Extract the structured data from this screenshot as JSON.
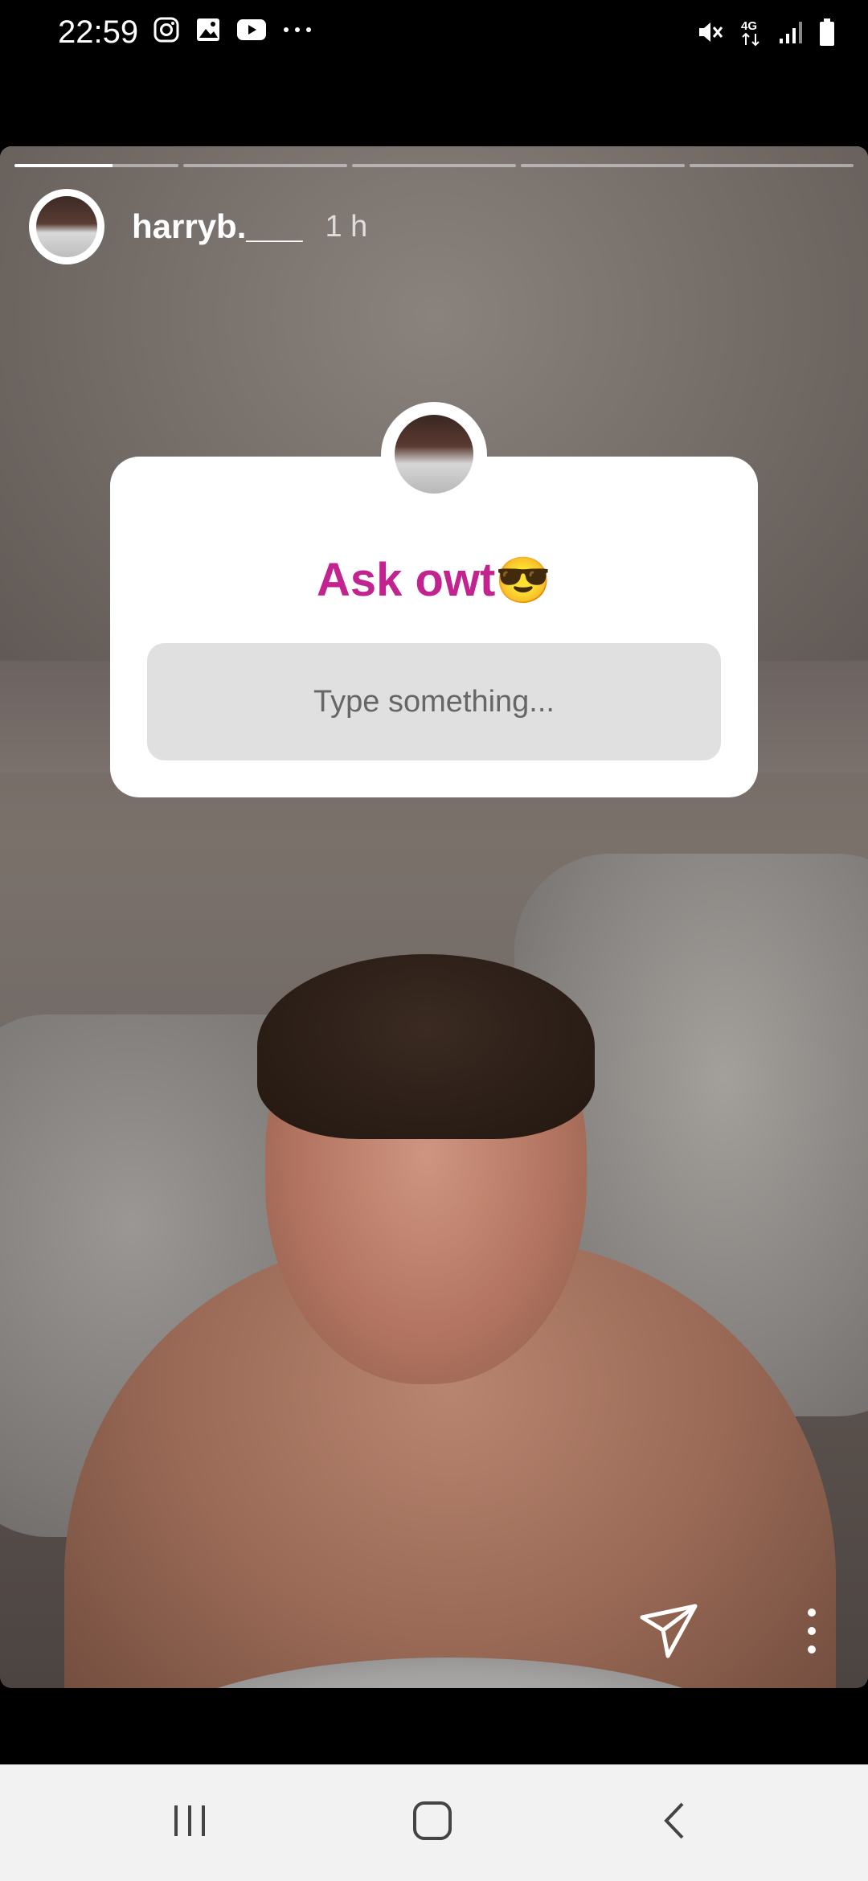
{
  "status_bar": {
    "time": "22:59",
    "left_icons": [
      "instagram-icon",
      "gallery-icon",
      "youtube-icon",
      "more-notifications-icon"
    ],
    "right_icons": [
      "mute-icon",
      "4g-icon",
      "signal-icon",
      "battery-icon"
    ],
    "network": "4G"
  },
  "story": {
    "progress_segments": 5,
    "active_segment": 0,
    "active_progress": 0.6,
    "username": "harryb.___",
    "time_ago": "1 h"
  },
  "sticker": {
    "title": "Ask owt",
    "emoji": "😎",
    "placeholder": "Type something...",
    "title_color": "#c3238f"
  },
  "actions": {
    "send_icon": "send-icon",
    "more_icon": "more-vertical-icon"
  },
  "nav": {
    "items": [
      "recent-apps-icon",
      "home-icon",
      "back-icon"
    ]
  }
}
